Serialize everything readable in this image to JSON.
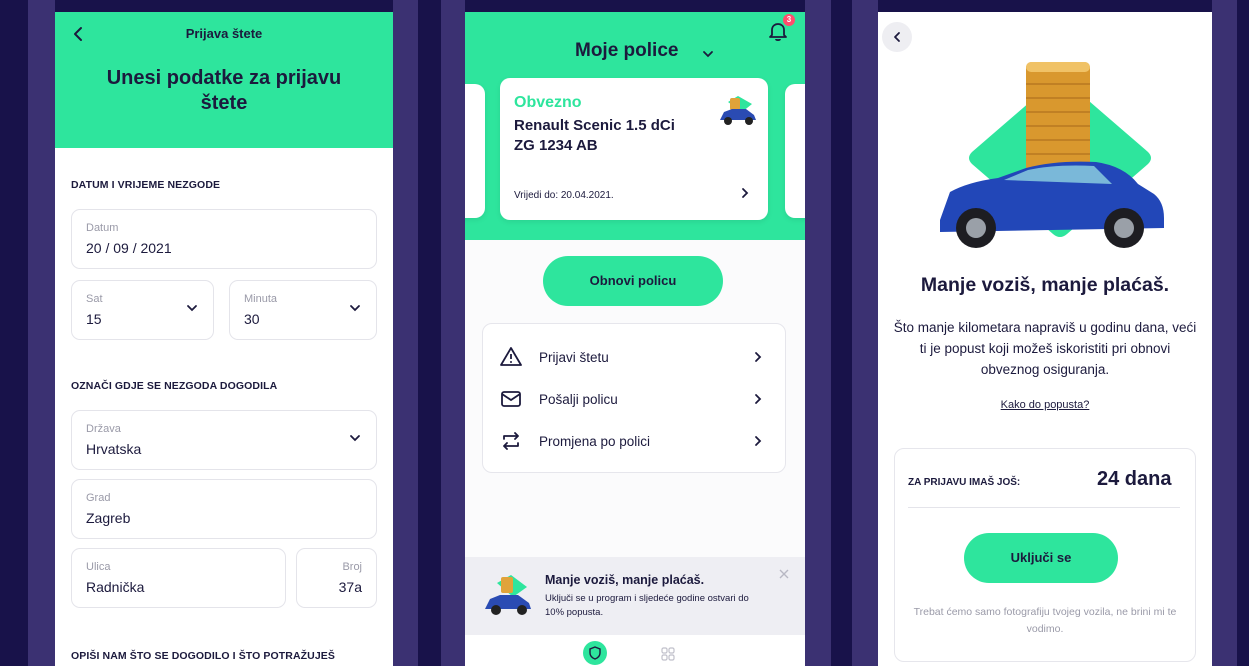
{
  "colors": {
    "accent": "#2ee59d",
    "text": "#1c1a3d",
    "background": "#18124a",
    "stripe": "#3b3172",
    "badge": "#ff4d6d"
  },
  "screen1": {
    "header_title": "Prijava štete",
    "heading": "Unesi podatke za prijavu štete",
    "section_datetime": "DATUM I VRIJEME NEZGODE",
    "date_label": "Datum",
    "date_value": "20 / 09 / 2021",
    "hour_label": "Sat",
    "hour_value": "15",
    "minute_label": "Minuta",
    "minute_value": "30",
    "section_location": "OZNAČI GDJE SE NEZGODA DOGODILA",
    "country_label": "Država",
    "country_value": "Hrvatska",
    "city_label": "Grad",
    "city_value": "Zagreb",
    "street_label": "Ulica",
    "street_value": "Radnička",
    "number_label": "Broj",
    "number_value": "37a",
    "section_describe": "OPIŠI NAM ŠTO SE DOGODILO I ŠTO POTRAŽUJEŠ"
  },
  "screen2": {
    "notification_count": "3",
    "title": "Moje police",
    "policy": {
      "type": "Obvezno",
      "name": "Renault Scenic 1.5 dCi",
      "plate": "ZG 1234 AB",
      "valid": "Vrijedi do: 20.04.2021."
    },
    "renew_button": "Obnovi policu",
    "menu": [
      {
        "label": "Prijavi štetu",
        "icon": "warning-icon"
      },
      {
        "label": "Pošalji policu",
        "icon": "mail-icon"
      },
      {
        "label": "Promjena po polici",
        "icon": "swap-icon"
      }
    ],
    "promo_title": "Manje voziš, manje plaćaš.",
    "promo_text": "Uključi se u program i sljedeće godine ostvari do 10% popusta."
  },
  "screen3": {
    "heading": "Manje voziš, manje plaćaš.",
    "description": "Što manje kilometara napraviš u godinu dana, veći ti je popust koji možeš iskoristiti pri obnovi obveznog osiguranja.",
    "link": "Kako do popusta?",
    "remaining_label": "ZA PRIJAVU IMAŠ JOŠ:",
    "remaining_value": "24 dana",
    "join_button": "Uključi se",
    "note": "Trebat ćemo samo fotografiju tvojeg vozila, ne brini mi te vodimo."
  }
}
